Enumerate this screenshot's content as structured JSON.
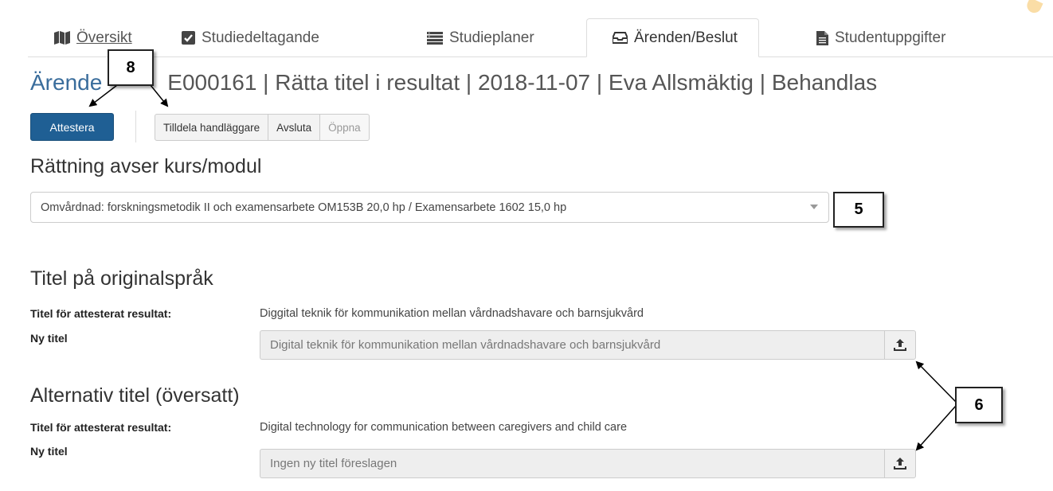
{
  "tabs": [
    {
      "label": "Översikt",
      "icon": "map-icon"
    },
    {
      "label": "Studiedeltagande",
      "icon": "checkbox-icon"
    },
    {
      "label": "Studieplaner",
      "icon": "list-icon"
    },
    {
      "label": "Ärenden/Beslut",
      "icon": "inbox-icon",
      "active": true
    },
    {
      "label": "Studentuppgifter",
      "icon": "file-icon"
    }
  ],
  "title": {
    "prefix": "Ärende",
    "main": "E000161 | Rätta titel i resultat | 2018-11-07 | Eva Allsmäktig | Behandlas"
  },
  "actions": {
    "primary": "Attestera",
    "group": [
      "Tilldela handläggare",
      "Avsluta",
      "Öppna"
    ]
  },
  "course_section": {
    "heading": "Rättning avser kurs/modul",
    "selected": "Omvårdnad: forskningsmetodik II och examensarbete OM153B 20,0 hp / Examensarbete 1602 15,0 hp"
  },
  "original_title": {
    "heading": "Titel på originalspråk",
    "attested_label": "Titel för attesterat resultat:",
    "attested_value": "Diggital teknik för kommunikation mellan vårdnadshavare och barnsjukvård",
    "new_label": "Ny titel",
    "new_value": "Digital teknik för kommunikation mellan vårdnadshavare och barnsjukvård"
  },
  "alt_title": {
    "heading": "Alternativ titel (översatt)",
    "attested_label": "Titel för attesterat resultat:",
    "attested_value": "Digital technology for communication between caregivers and child care",
    "new_label": "Ny titel",
    "new_placeholder": "Ingen ny titel föreslagen"
  },
  "callouts": {
    "c8": "8",
    "c5": "5",
    "c6": "6"
  },
  "colors": {
    "primary_button": "#1f5f94",
    "title_link": "#3a6d9c"
  }
}
